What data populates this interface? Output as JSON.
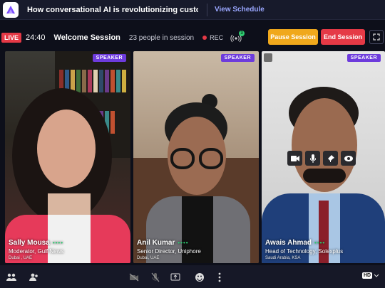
{
  "header": {
    "title": "How conversational AI is revolutionizing customer ...",
    "view_schedule": "View Schedule"
  },
  "session": {
    "live": "LIVE",
    "timer": "24:40",
    "name": "Welcome Session",
    "people": "23 people in session",
    "rec": "REC",
    "signal_badge": "3",
    "pause_label": "Pause Session",
    "end_label": "End Session"
  },
  "tiles": [
    {
      "badge": "SPEAKER",
      "name": "Sally Mousa",
      "role": "Moderator, Gulf News",
      "location": "Dubai , UAE"
    },
    {
      "badge": "SPEAKER",
      "name": "Anil Kumar",
      "role": "Senior Director, Uniphore",
      "location": "Dubai, UAE"
    },
    {
      "badge": "SPEAKER",
      "name": "Awais Ahmad",
      "role": "Head of Technology, Solexplus",
      "location": "Saudi Arabia, KSA"
    }
  ],
  "controls": {
    "hd": "HD"
  },
  "colors": {
    "accent": "#6d3bdc",
    "live": "#e53946",
    "pause": "#f0a81c",
    "end": "#e53946",
    "link": "#9aa7ff"
  }
}
